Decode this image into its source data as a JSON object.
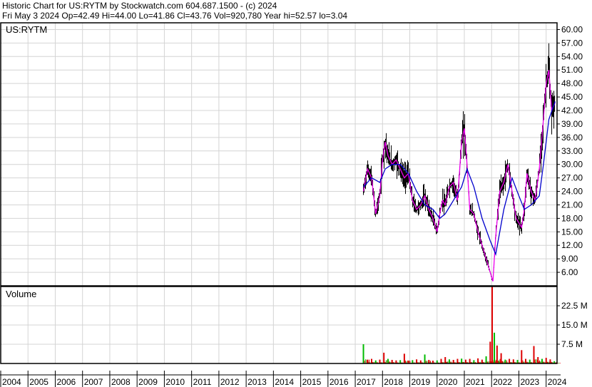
{
  "header": {
    "line1": "Historic Chart for US:RYTM by Stockwatch.com 604.687.1500 - (c) 2024",
    "line2": "Fri May  3 2024   Op=42.49   Hi=44.00   Lo=41.86   Cl=43.76   Vol=920,780   Year hi=52.57   lo=3.04"
  },
  "chart_data": [
    {
      "type": "line",
      "symbol_label": "US:RYTM",
      "price_ticks": [
        "60.00",
        "57.00",
        "54.00",
        "51.00",
        "48.00",
        "45.00",
        "42.00",
        "39.00",
        "36.00",
        "33.00",
        "30.00",
        "27.00",
        "24.00",
        "21.00",
        "18.00",
        "15.00",
        "12.00",
        "9.00",
        "6.00"
      ],
      "ylim": [
        3.0,
        61.5
      ],
      "x_ticks": [
        "2004",
        "2005",
        "2006",
        "2007",
        "2008",
        "2009",
        "2010",
        "2011",
        "2012",
        "2013",
        "2014",
        "2015",
        "2016",
        "2017",
        "2018",
        "2019",
        "2020",
        "2021",
        "2022",
        "2023",
        "2024"
      ],
      "xlim": [
        2004.0,
        2024.4
      ],
      "grid": true,
      "series": [
        {
          "x": [
            2017.3,
            2017.45,
            2017.6,
            2017.75,
            2017.9,
            2018.0,
            2018.1,
            2018.2,
            2018.35,
            2018.5,
            2018.65,
            2018.8,
            2018.95,
            2019.1,
            2019.25,
            2019.4,
            2019.55,
            2019.7,
            2019.85,
            2020.0,
            2020.1,
            2020.2,
            2020.3,
            2020.45,
            2020.6,
            2020.75,
            2020.9,
            2021.0,
            2021.1,
            2021.2,
            2021.35,
            2021.5,
            2021.65,
            2021.8,
            2021.95,
            2022.05,
            2022.15,
            2022.3,
            2022.45,
            2022.6,
            2022.75,
            2022.9,
            2023.0,
            2023.1,
            2023.2,
            2023.3,
            2023.45,
            2023.6,
            2023.75,
            2023.9,
            2024.0,
            2024.1,
            2024.2,
            2024.33
          ],
          "y": [
            24,
            29,
            27,
            19,
            23,
            31,
            35,
            32,
            30,
            31,
            29,
            27,
            28,
            22,
            20,
            21,
            23,
            20,
            18,
            15,
            19,
            22,
            21,
            25,
            26,
            22,
            35,
            38,
            30,
            20,
            19,
            15,
            12,
            9,
            6,
            4,
            14,
            24,
            26,
            30,
            24,
            18,
            17,
            16,
            20,
            28,
            24,
            22,
            29,
            40,
            48,
            51,
            42,
            43.76
          ]
        },
        {
          "x": [
            2017.3,
            2017.6,
            2017.9,
            2018.1,
            2018.35,
            2018.65,
            2018.95,
            2019.25,
            2019.55,
            2019.85,
            2020.1,
            2020.3,
            2020.6,
            2020.9,
            2021.1,
            2021.35,
            2021.65,
            2021.95,
            2022.15,
            2022.45,
            2022.75,
            2023.0,
            2023.2,
            2023.45,
            2023.75,
            2023.9,
            2024.1,
            2024.33
          ],
          "y": [
            25,
            27,
            26,
            29,
            30,
            30,
            28,
            24,
            21,
            20,
            18,
            19,
            22,
            25,
            29,
            25,
            18,
            13,
            10,
            20,
            27,
            23,
            20,
            21,
            23,
            30,
            40,
            44
          ]
        }
      ]
    },
    {
      "type": "bar",
      "title": "Volume",
      "volume_ticks": [
        "22.5 M",
        "15.0 M",
        "7.5 M"
      ],
      "ylim": [
        0,
        30
      ],
      "xlim": [
        2004.0,
        2024.4
      ],
      "x": [
        2017.3,
        2017.45,
        2017.6,
        2017.75,
        2017.9,
        2018.05,
        2018.2,
        2018.35,
        2018.5,
        2018.65,
        2018.8,
        2018.95,
        2019.1,
        2019.25,
        2019.4,
        2019.55,
        2019.7,
        2019.85,
        2020.0,
        2020.15,
        2020.3,
        2020.45,
        2020.6,
        2020.75,
        2020.9,
        2021.05,
        2021.2,
        2021.35,
        2021.5,
        2021.65,
        2021.8,
        2021.95,
        2022.02,
        2022.1,
        2022.2,
        2022.35,
        2022.5,
        2022.65,
        2022.8,
        2022.95,
        2023.1,
        2023.25,
        2023.4,
        2023.55,
        2023.7,
        2023.85,
        2024.0,
        2024.15,
        2024.3
      ],
      "values": [
        7.5,
        1.5,
        1.8,
        1.2,
        1.5,
        4.2,
        1.8,
        1.4,
        1.2,
        1.3,
        3.8,
        1.1,
        1.3,
        1.6,
        1.2,
        3.5,
        1.4,
        1.1,
        1.2,
        1.8,
        2.5,
        1.6,
        1.4,
        1.8,
        1.9,
        1.5,
        1.8,
        1.3,
        2.0,
        1.5,
        2.8,
        8.5,
        30.0,
        12.0,
        7.0,
        4.0,
        1.5,
        1.8,
        1.6,
        1.4,
        5.2,
        1.8,
        1.5,
        6.8,
        2.5,
        1.8,
        2.2,
        1.6,
        0.9
      ],
      "up_color": "#00bb00",
      "down_color": "#dd0000"
    }
  ]
}
